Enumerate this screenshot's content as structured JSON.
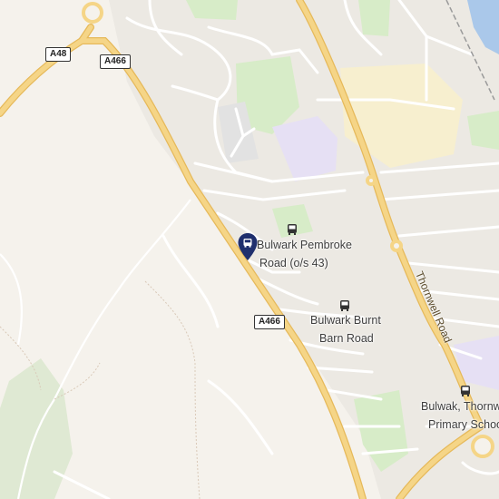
{
  "map": {
    "colors": {
      "land": "#f5f2ec",
      "urban": "#ece9e3",
      "park": "#d7ecc8",
      "school": "#e6e0f4",
      "commercial": "#f7efcf",
      "water": "#aac8ea",
      "major_road": "#f5d587",
      "major_road_casing": "#e6b95a",
      "minor_road": "#ffffff",
      "pin": "#1f2f6d"
    },
    "road_shields": [
      {
        "id": "a48",
        "label": "A48"
      },
      {
        "id": "a466-north",
        "label": "A466"
      },
      {
        "id": "a466-south",
        "label": "A466"
      }
    ],
    "road_names": [
      {
        "id": "thornwell-road",
        "label": "Thornwell Road"
      }
    ],
    "bus_stops": [
      {
        "id": "pembroke",
        "line1": "Bulwark Pembroke",
        "line2": "Road (o/s 43)",
        "icon": "bus-icon"
      },
      {
        "id": "burnt-barn",
        "line1": "Bulwark Burnt",
        "line2": "Barn Road",
        "icon": "bus-icon"
      },
      {
        "id": "school",
        "line1": "Bulwak, Thornw",
        "line2": "Primary Schoo",
        "icon": "bus-icon"
      }
    ],
    "selected_marker": {
      "icon": "location-pin-icon"
    }
  }
}
